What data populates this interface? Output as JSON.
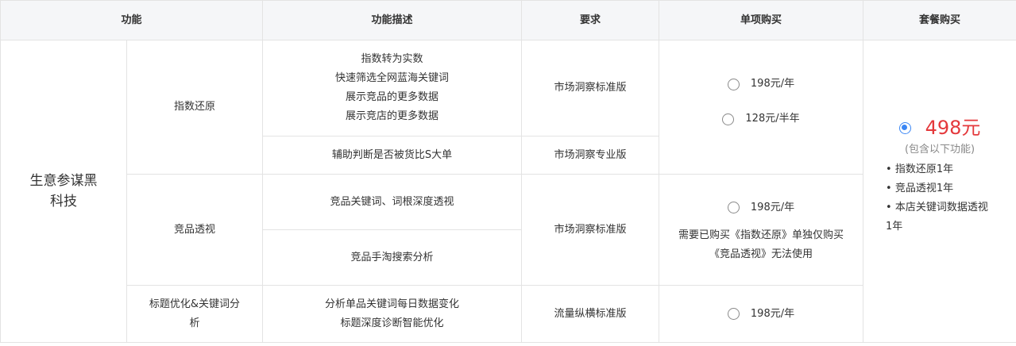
{
  "header": {
    "feature": "功能",
    "description": "功能描述",
    "requirement": "要求",
    "single_purchase": "单项购买",
    "package_purchase": "套餐购买"
  },
  "product": "生意参谋黑科技",
  "features": {
    "index_restore": {
      "name": "指数还原",
      "desc_lines": [
        "指数转为实数",
        "快速筛选全网蓝海关键词",
        "展示竞品的更多数据",
        "展示竞店的更多数据"
      ],
      "requirement": "市场洞察标准版",
      "sub_desc": "辅助判断是否被货比S大单",
      "sub_requirement": "市场洞察专业版",
      "options": [
        "198元/年",
        "128元/半年"
      ]
    },
    "competitor_insight": {
      "name": "竞品透视",
      "desc_1": "竞品关键词、词根深度透视",
      "desc_2": "竞品手淘搜索分析",
      "requirement": "市场洞察标准版",
      "option": "198元/年",
      "note": "需要已购买《指数还原》单独仅购买《竞品透视》无法使用"
    },
    "title_optimization": {
      "name": "标题优化&关键词分析",
      "desc_lines": [
        "分析单品关键词每日数据变化",
        "标题深度诊断智能优化"
      ],
      "requirement": "流量纵横标准版",
      "option": "198元/年"
    }
  },
  "package": {
    "price": "498元",
    "note": "(包含以下功能)",
    "items": [
      "• 指数还原1年",
      "• 竞品透视1年",
      "• 本店关键词数据透视1年"
    ],
    "selected": true
  },
  "colors": {
    "header_bg": "#f5f6f8",
    "border": "#e3e3e3",
    "price": "#e4393c",
    "radio_selected": "#3a86f4"
  }
}
